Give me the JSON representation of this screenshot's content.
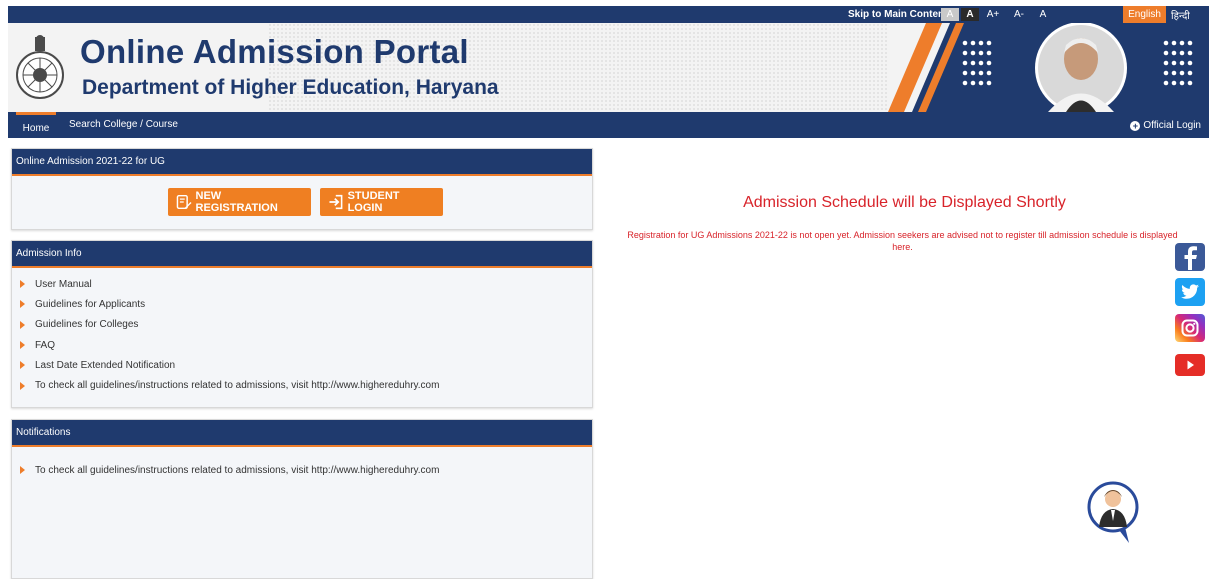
{
  "topbar": {
    "skip_label": "Skip to Main Content",
    "font_sizes": [
      "A",
      "A",
      "A+",
      "A-",
      "A"
    ],
    "language_en": "English",
    "language_hi": "हिन्दी"
  },
  "header": {
    "title": "Online Admission Portal",
    "subtitle": "Department of Higher Education, Haryana"
  },
  "nav": {
    "home": "Home",
    "search": "Search College / Course",
    "official_login": "Official Login"
  },
  "panels": {
    "admission": {
      "title": "Online Admission 2021-22 for UG",
      "new_registration": "NEW REGISTRATION",
      "student_login": "STUDENT LOGIN"
    },
    "info": {
      "title": "Admission Info",
      "items": [
        "User Manual",
        "Guidelines for Applicants",
        "Guidelines for Colleges",
        "FAQ",
        "Last Date Extended Notification",
        "To check all guidelines/instructions related to admissions, visit http://www.highereduhry.com"
      ]
    },
    "notifications": {
      "title": "Notifications",
      "items": [
        "To check all guidelines/instructions related to admissions, visit http://www.highereduhry.com"
      ]
    }
  },
  "main": {
    "schedule": "Admission Schedule will be Displayed Shortly",
    "note": "Registration for UG Admissions 2021-22 is not open yet. Admission seekers are advised not to register till admission schedule is displayed here."
  },
  "social": [
    "facebook-icon",
    "twitter-icon",
    "instagram-icon",
    "youtube-icon"
  ],
  "colors": {
    "navy": "#1f3a6e",
    "orange": "#ee7d2b",
    "alert_red": "#d8232a"
  }
}
